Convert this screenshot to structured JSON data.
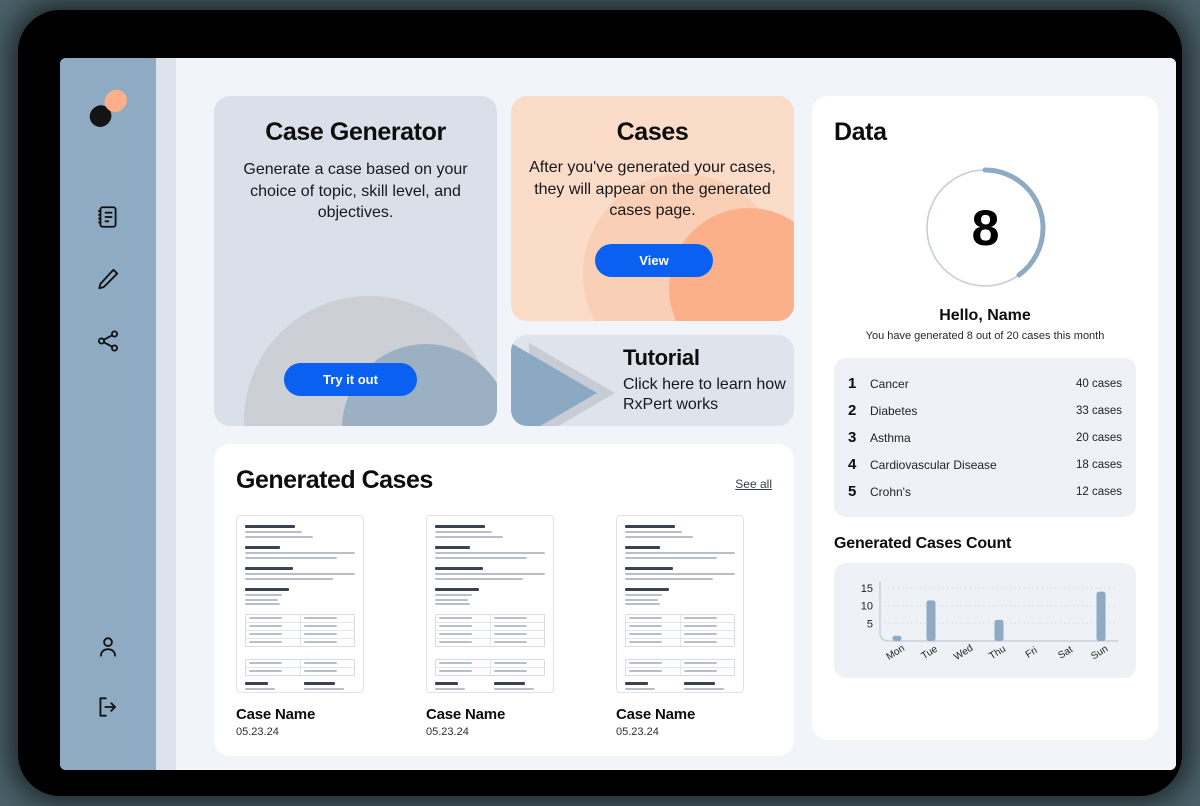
{
  "app": {
    "name": "RxPert",
    "logo_icon": "pill-capsule-icon"
  },
  "sidebar": {
    "items": [
      {
        "icon": "notebook-icon",
        "name": "notes"
      },
      {
        "icon": "pencil-icon",
        "name": "edit"
      },
      {
        "icon": "share-icon",
        "name": "share"
      }
    ],
    "bottom_items": [
      {
        "icon": "user-icon",
        "name": "profile"
      },
      {
        "icon": "logout-icon",
        "name": "logout"
      }
    ]
  },
  "case_generator": {
    "title": "Case Generator",
    "description": "Generate a case based on your choice of topic, skill level, and objectives.",
    "button_label": "Try it out"
  },
  "cases": {
    "title": "Cases",
    "description": "After you've generated your cases, they will appear on the generated cases page.",
    "button_label": "View"
  },
  "tutorial": {
    "title": "Tutorial",
    "description": "Click here to learn how RxPert works",
    "icon": "play-triangle-icon"
  },
  "generated_cases": {
    "title": "Generated Cases",
    "see_all_label": "See all",
    "items": [
      {
        "name": "Case Name",
        "date": "05.23.24"
      },
      {
        "name": "Case Name",
        "date": "05.23.24"
      },
      {
        "name": "Case Name",
        "date": "05.23.24"
      }
    ]
  },
  "data": {
    "title": "Data",
    "donut_value": "8",
    "donut_total": 20,
    "donut_percent": 40,
    "greeting": "Hello, Name",
    "summary": "You have generated 8 out of 20 cases this month",
    "rankings": [
      {
        "rank": "1",
        "label": "Cancer",
        "value": "40 cases"
      },
      {
        "rank": "2",
        "label": "Diabetes",
        "value": "33 cases"
      },
      {
        "rank": "3",
        "label": "Asthma",
        "value": "20 cases"
      },
      {
        "rank": "4",
        "label": "Cardiovascular Disease",
        "value": "18 cases"
      },
      {
        "rank": "5",
        "label": "Crohn's",
        "value": "12 cases"
      }
    ]
  },
  "chart_data": {
    "type": "bar",
    "title": "Generated Cases Count",
    "categories": [
      "Mon",
      "Tue",
      "Wed",
      "Thu",
      "Fri",
      "Sat",
      "Sun"
    ],
    "values": [
      1.5,
      11.5,
      0,
      6,
      0,
      0,
      14
    ],
    "xlabel": "",
    "ylabel": "",
    "ylim": [
      0,
      17
    ],
    "yticks": [
      5,
      10,
      15
    ],
    "grid": true,
    "legend": false,
    "bar_color": "#8fabc3"
  },
  "colors": {
    "accent_blue": "#0a60f0",
    "sidebar": "#8fabc3",
    "peach": "#fbdcc9",
    "slate": "#dae0e9",
    "bg": "#f1f5f9"
  }
}
